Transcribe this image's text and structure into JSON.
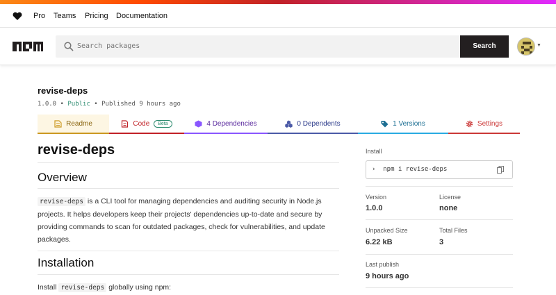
{
  "brand_gradient": [
    "#fb8817",
    "#ff4b01",
    "#c12127",
    "#e02aff"
  ],
  "top_nav": {
    "links": [
      "Pro",
      "Teams",
      "Pricing",
      "Documentation"
    ],
    "heart_icon": "heart-icon"
  },
  "search": {
    "placeholder": "Search packages",
    "button_label": "Search"
  },
  "package": {
    "name": "revise-deps",
    "version": "1.0.0",
    "visibility": "Public",
    "published": "Published 9 hours ago"
  },
  "tabs": [
    {
      "label": "Readme",
      "icon": "readme-icon",
      "color": "#cb9820",
      "active": true
    },
    {
      "label": "Code",
      "icon": "code-icon",
      "badge": "Beta",
      "color": "#c12127"
    },
    {
      "label": "4 Dependencies",
      "icon": "dependencies-icon",
      "color": "#8956ff"
    },
    {
      "label": "0 Dependents",
      "icon": "dependents-icon",
      "color": "#4b5aa7"
    },
    {
      "label": "1 Versions",
      "icon": "versions-icon",
      "color": "#29abe2"
    },
    {
      "label": "Settings",
      "icon": "settings-icon",
      "color": "#cb3837"
    }
  ],
  "readme": {
    "title": "revise-deps",
    "overview_heading": "Overview",
    "overview_code": "revise-deps",
    "overview_text": " is a CLI tool for managing dependencies and auditing security in Node.js projects. It helps developers keep their projects' dependencies up-to-date and secure by providing commands to scan for outdated packages, check for vulnerabilities, and update packages.",
    "installation_heading": "Installation",
    "install_prefix": "Install ",
    "install_code": "revise-deps",
    "install_suffix": " globally using npm:"
  },
  "sidebar": {
    "install_label": "Install",
    "install_command": "npm i revise-deps",
    "version_label": "Version",
    "version_value": "1.0.0",
    "license_label": "License",
    "license_value": "none",
    "unpacked_label": "Unpacked Size",
    "unpacked_value": "6.22 kB",
    "files_label": "Total Files",
    "files_value": "3",
    "last_publish_label": "Last publish",
    "last_publish_value": "9 hours ago"
  }
}
